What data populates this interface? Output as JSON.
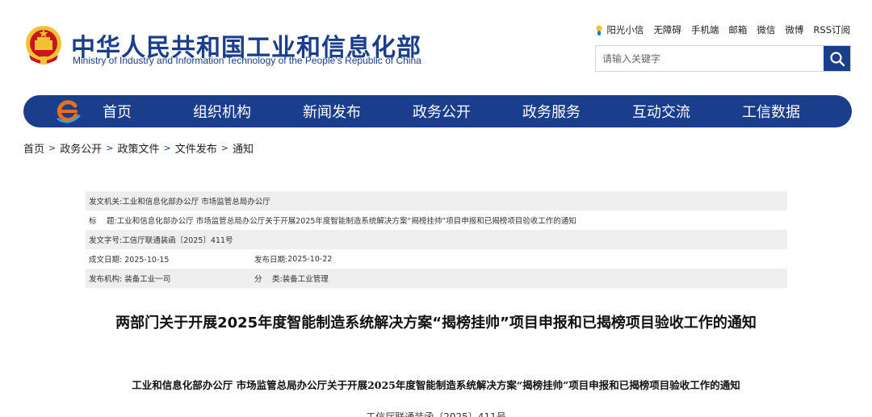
{
  "header": {
    "title_cn": "中华人民共和国工业和信息化部",
    "title_en": "Ministry of Industry and Information Technology of the People’s Republic of China",
    "emblem": "national-emblem",
    "top_links": [
      "阳光小信",
      "无障碍",
      "手机端",
      "邮箱",
      "微信",
      "微博",
      "RSS订阅"
    ],
    "search_placeholder": "请输入关键字",
    "search_icon": "search-icon"
  },
  "nav": {
    "logo": "miit-logo",
    "items": [
      "首页",
      "组织机构",
      "新闻发布",
      "政务公开",
      "政务服务",
      "互动交流",
      "工信数据"
    ]
  },
  "breadcrumb": {
    "items": [
      "首页",
      "政务公开",
      "政策文件",
      "文件发布",
      "通知"
    ],
    "separator": ">"
  },
  "meta": {
    "issuer_label": "发文机关:",
    "issuer": "工业和信息化部办公厅 市场监管总局办公厅",
    "title_label": "标　 题:",
    "title": "工业和信息化部办公厅 市场监管总局办公厅关于开展2025年度智能制造系统解决方案“揭榜挂帅”项目申报和已揭榜项目验收工作的通知",
    "docno_label": "发文字号:",
    "docno": "工信厅联通装函〔2025〕411号",
    "created_label": "成文日期:",
    "created": "2025-10-15",
    "published_label": "发布日期:",
    "published": "2025-10-22",
    "org_label": "发布机构:",
    "org": "装备工业一司",
    "category_label": "分　 类:",
    "category": "装备工业管理"
  },
  "article": {
    "title": "两部门关于开展2025年度智能制造系统解决方案“揭榜挂帅”项目申报和已揭榜项目验收工作的通知",
    "subtitle": "工业和信息化部办公厅  市场监管总局办公厅关于开展2025年度智能制造系统解决方案“揭榜挂帅”项目申报和已揭榜项目验收工作的通知",
    "docno": "工信厅联通装函〔2025〕411号"
  },
  "colors": {
    "brand": "#1a3e8c",
    "emblem_red": "#c8161d",
    "emblem_gold": "#f2c230",
    "logo_orange": "#e8701c"
  }
}
